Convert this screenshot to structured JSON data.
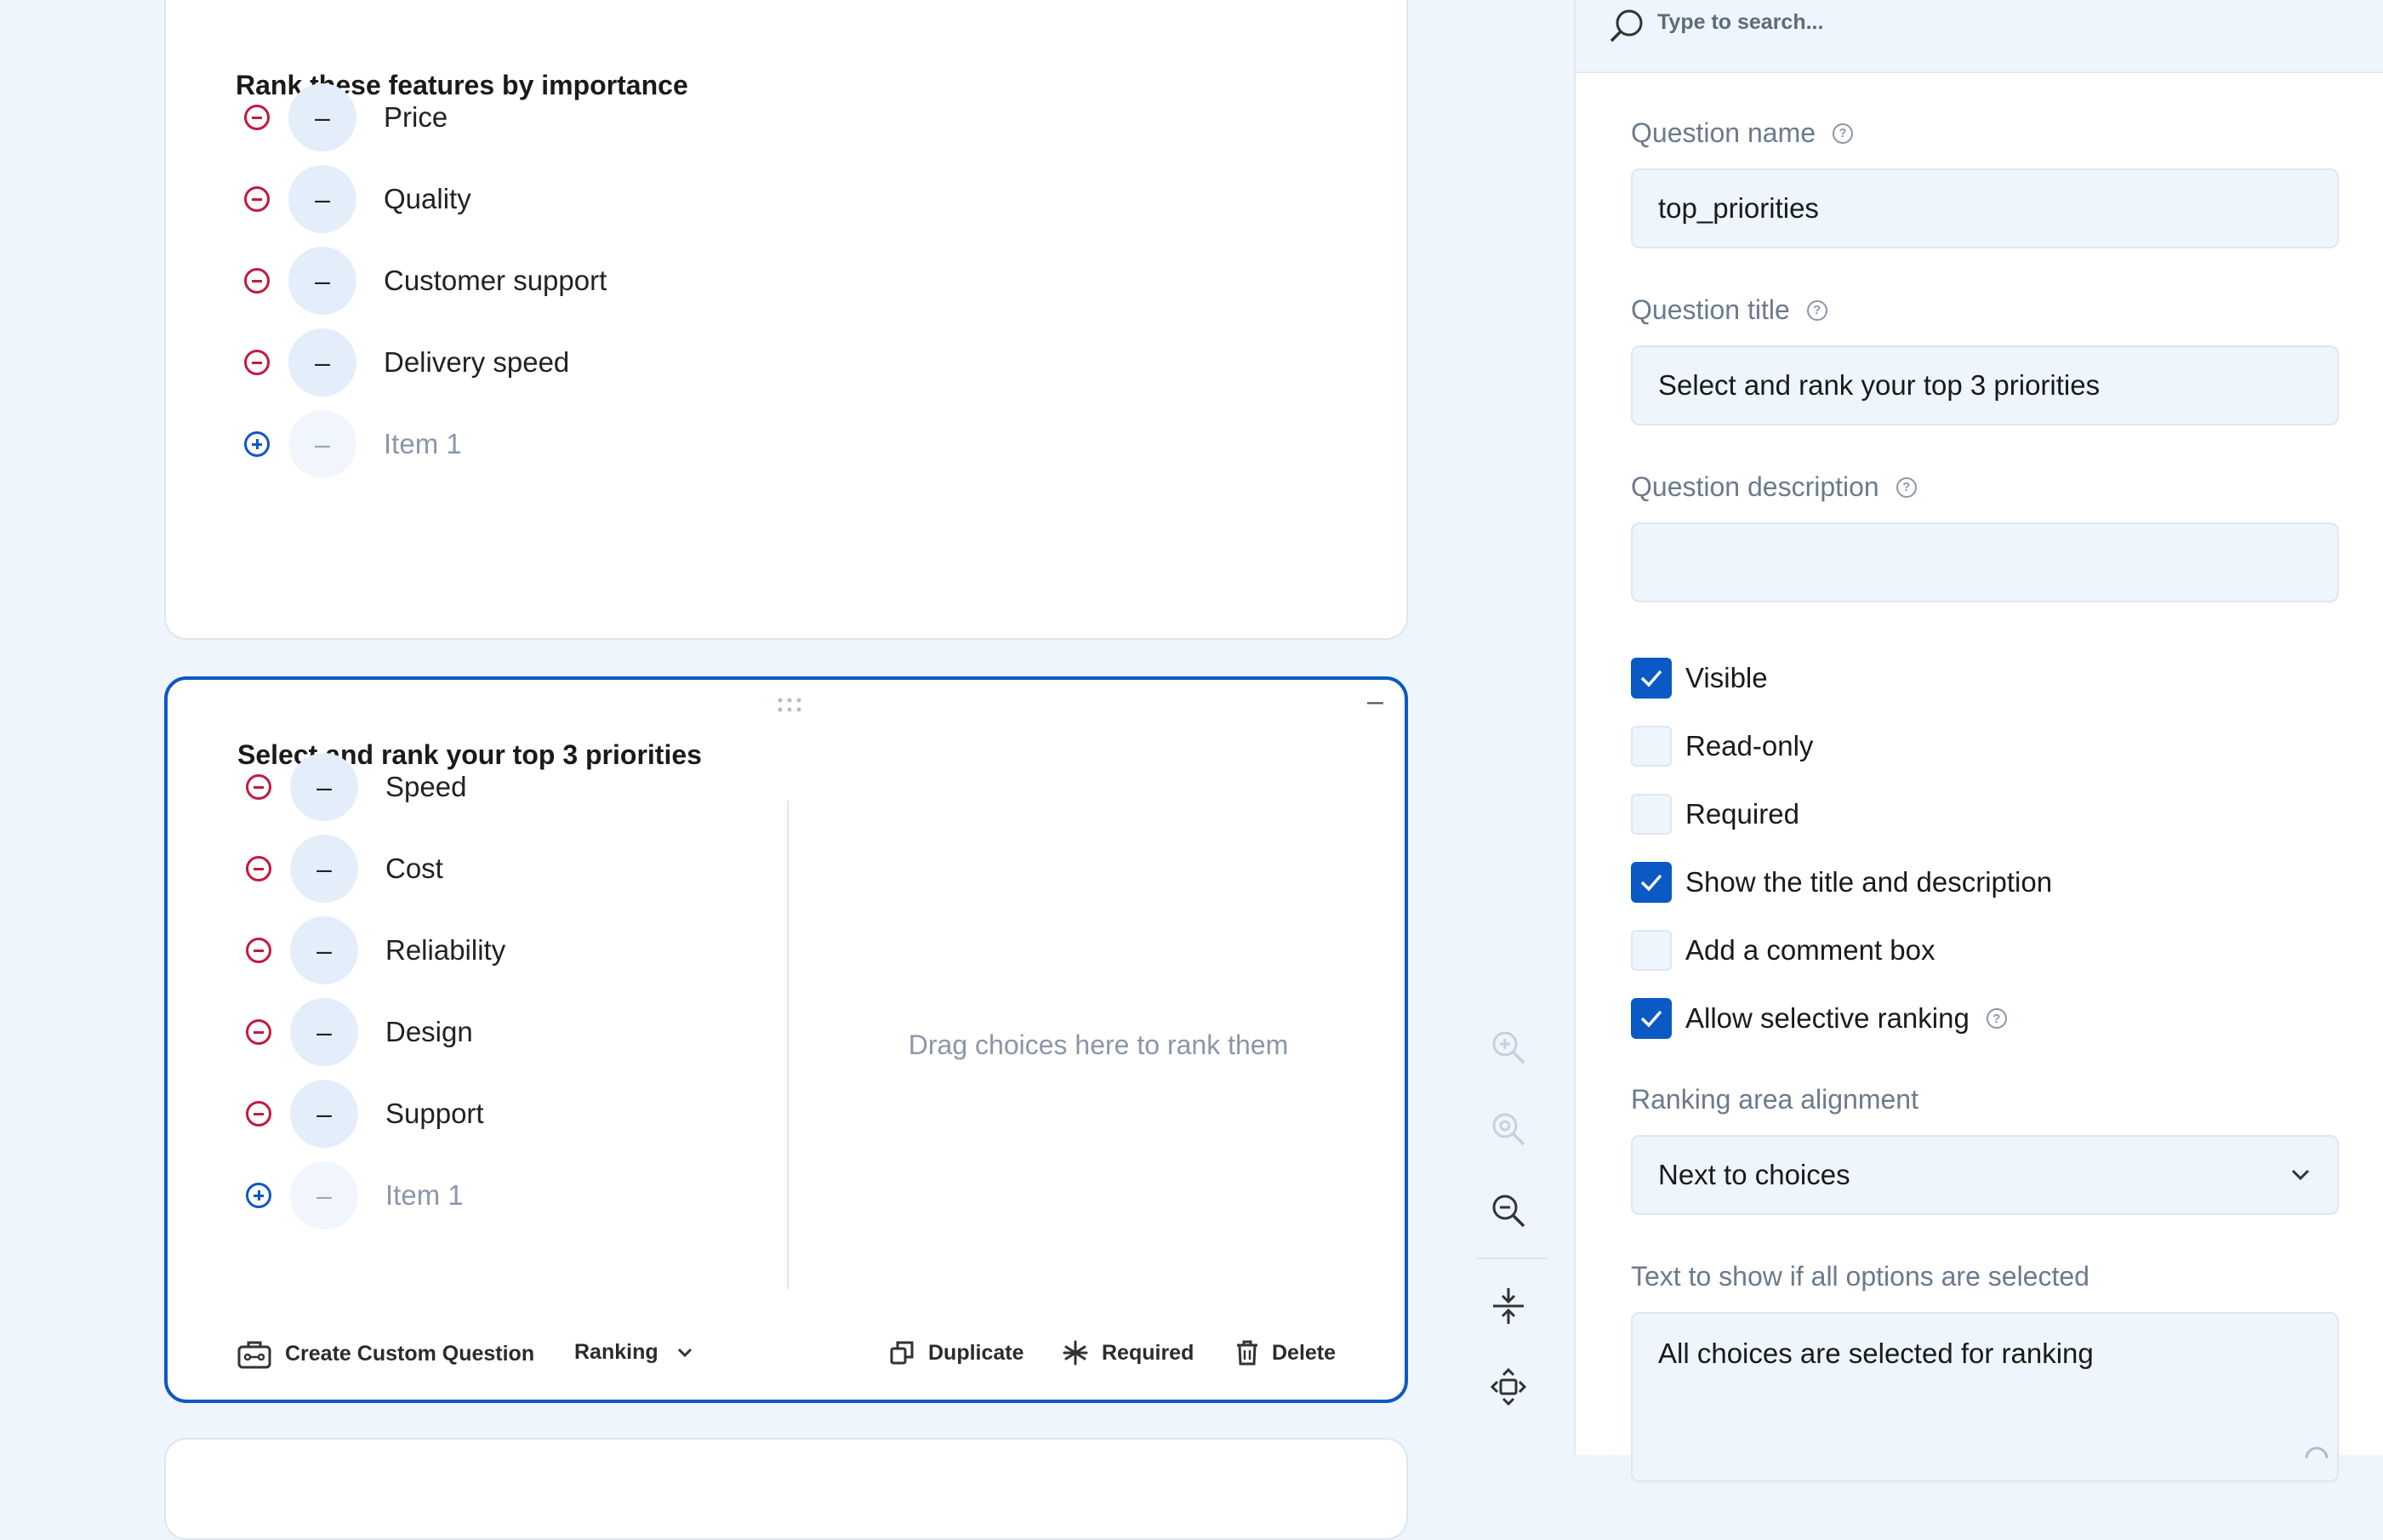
{
  "question1": {
    "title": "Rank these features by importance",
    "choices": [
      "Price",
      "Quality",
      "Customer support",
      "Delivery speed"
    ],
    "new_item": "Item 1",
    "badge": "–"
  },
  "question2": {
    "title": "Select and rank your top 3 priorities",
    "choices": [
      "Speed",
      "Cost",
      "Reliability",
      "Design",
      "Support"
    ],
    "new_item": "Item 1",
    "badge": "–",
    "drop_hint": "Drag choices here to rank them",
    "collapse": "–",
    "toolbar": {
      "custom": "Create Custom Question",
      "type": "Ranking",
      "duplicate": "Duplicate",
      "required": "Required",
      "delete": "Delete"
    }
  },
  "panel": {
    "search_placeholder": "Type to search...",
    "question_name_label": "Question name",
    "question_name_value": "top_priorities",
    "question_title_label": "Question title",
    "question_title_value": "Select and rank your top 3 priorities",
    "question_description_label": "Question description",
    "question_description_value": "",
    "help": "?",
    "checkboxes": [
      {
        "label": "Visible",
        "checked": true
      },
      {
        "label": "Read-only",
        "checked": false
      },
      {
        "label": "Required",
        "checked": false
      },
      {
        "label": "Show the title and description",
        "checked": true
      },
      {
        "label": "Add a comment box",
        "checked": false
      },
      {
        "label": "Allow selective ranking",
        "checked": true
      }
    ],
    "ranking_alignment_label": "Ranking area alignment",
    "ranking_alignment_value": "Next to choices",
    "all_selected_label": "Text to show if all options are selected",
    "all_selected_value": "All choices are selected for ranking"
  },
  "colors": {
    "accent": "#0a59c4",
    "remove": "#c21a3f",
    "add": "#1057c4"
  }
}
